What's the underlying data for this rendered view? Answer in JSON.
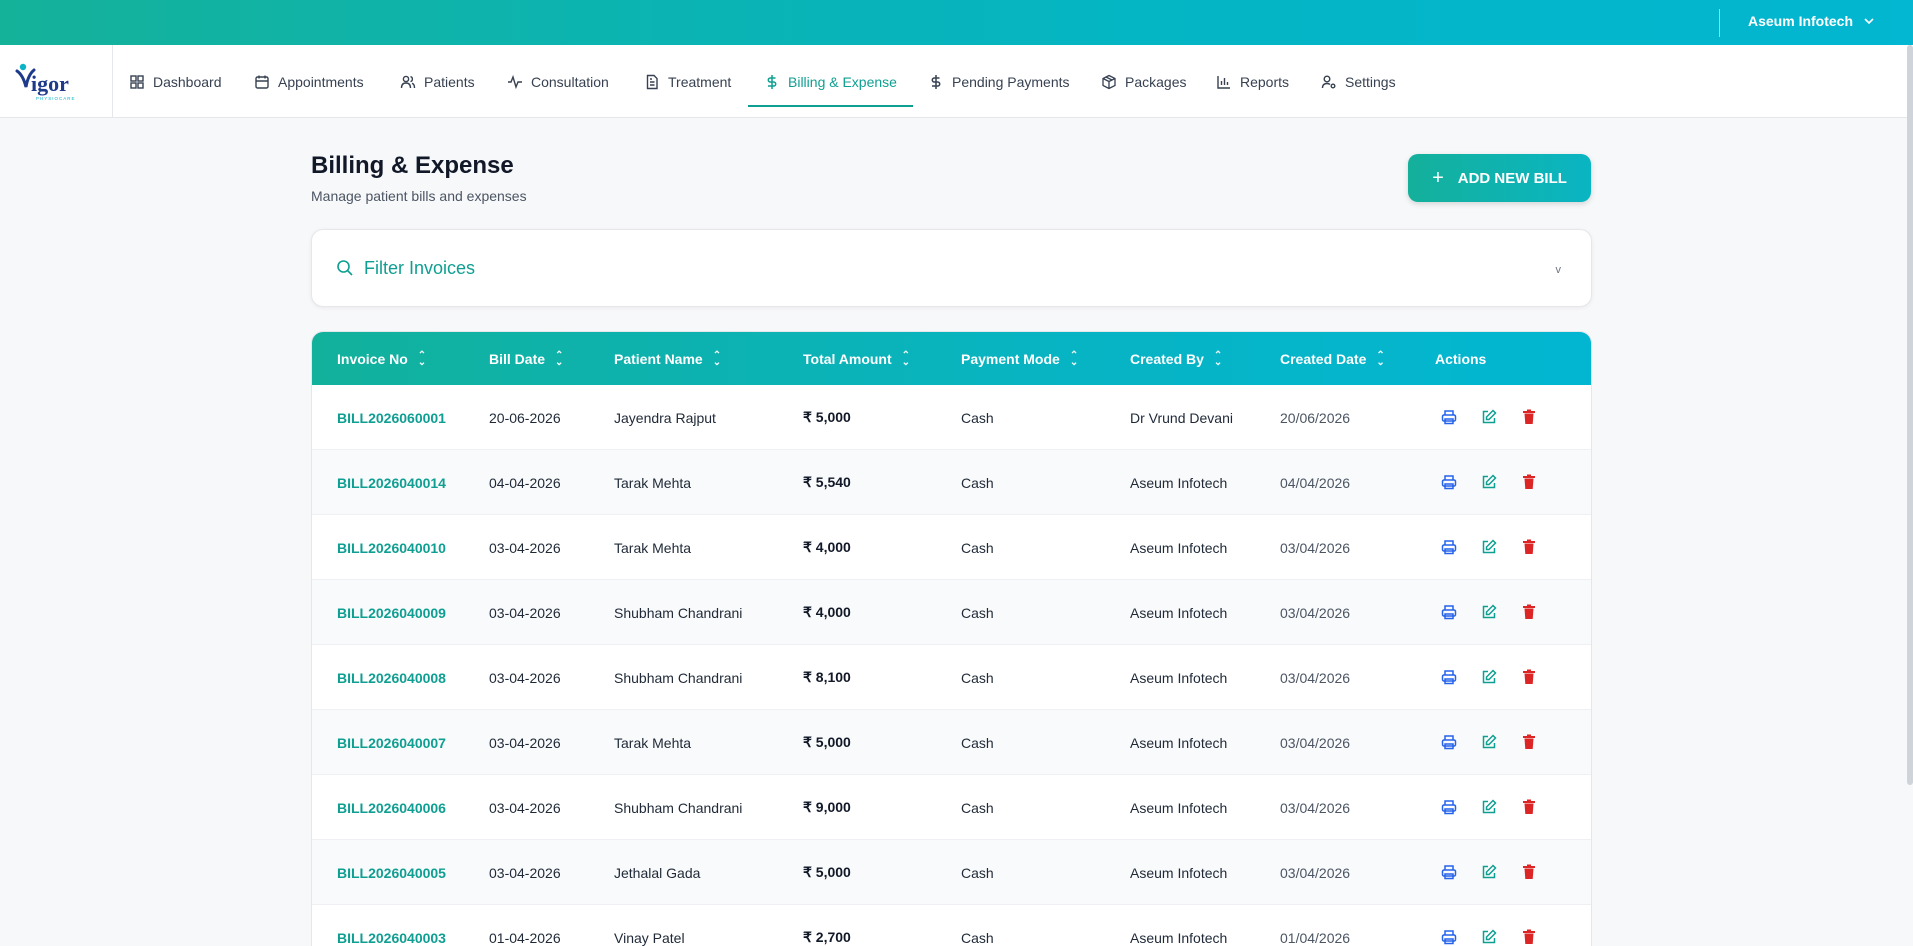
{
  "topbar": {
    "user_name": "Aseum Infotech"
  },
  "logo": {
    "text": "igor",
    "tagline": "PHYSIOCARE"
  },
  "nav": [
    {
      "label": "Dashboard",
      "icon": "grid-icon"
    },
    {
      "label": "Appointments",
      "icon": "calendar-icon"
    },
    {
      "label": "Patients",
      "icon": "users-icon"
    },
    {
      "label": "Consultation",
      "icon": "activity-icon"
    },
    {
      "label": "Treatment",
      "icon": "file-icon"
    },
    {
      "label": "Billing & Expense",
      "icon": "dollar-icon",
      "active": true
    },
    {
      "label": "Pending Payments",
      "icon": "dollar-icon"
    },
    {
      "label": "Packages",
      "icon": "package-icon"
    },
    {
      "label": "Reports",
      "icon": "bar-chart-icon"
    },
    {
      "label": "Settings",
      "icon": "user-cog-icon"
    }
  ],
  "page": {
    "title": "Billing & Expense",
    "subtitle": "Manage patient bills and expenses",
    "add_button": "ADD NEW BILL"
  },
  "filter": {
    "label": "Filter Invoices",
    "chevron": "v"
  },
  "table": {
    "headers": [
      "Invoice No",
      "Bill Date",
      "Patient Name",
      "Total Amount",
      "Payment Mode",
      "Created By",
      "Created Date",
      "Actions"
    ],
    "rows": [
      {
        "invoice": "BILL2026060001",
        "bill_date": "20-06-2026",
        "patient": "Jayendra Rajput",
        "amount": "₹ 5,000",
        "mode": "Cash",
        "created_by": "Dr Vrund Devani",
        "created_date": "20/06/2026"
      },
      {
        "invoice": "BILL2026040014",
        "bill_date": "04-04-2026",
        "patient": "Tarak Mehta",
        "amount": "₹ 5,540",
        "mode": "Cash",
        "created_by": "Aseum Infotech",
        "created_date": "04/04/2026"
      },
      {
        "invoice": "BILL2026040010",
        "bill_date": "03-04-2026",
        "patient": "Tarak Mehta",
        "amount": "₹ 4,000",
        "mode": "Cash",
        "created_by": "Aseum Infotech",
        "created_date": "03/04/2026"
      },
      {
        "invoice": "BILL2026040009",
        "bill_date": "03-04-2026",
        "patient": "Shubham Chandrani",
        "amount": "₹ 4,000",
        "mode": "Cash",
        "created_by": "Aseum Infotech",
        "created_date": "03/04/2026"
      },
      {
        "invoice": "BILL2026040008",
        "bill_date": "03-04-2026",
        "patient": "Shubham Chandrani",
        "amount": "₹ 8,100",
        "mode": "Cash",
        "created_by": "Aseum Infotech",
        "created_date": "03/04/2026"
      },
      {
        "invoice": "BILL2026040007",
        "bill_date": "03-04-2026",
        "patient": "Tarak Mehta",
        "amount": "₹ 5,000",
        "mode": "Cash",
        "created_by": "Aseum Infotech",
        "created_date": "03/04/2026"
      },
      {
        "invoice": "BILL2026040006",
        "bill_date": "03-04-2026",
        "patient": "Shubham Chandrani",
        "amount": "₹ 9,000",
        "mode": "Cash",
        "created_by": "Aseum Infotech",
        "created_date": "03/04/2026"
      },
      {
        "invoice": "BILL2026040005",
        "bill_date": "03-04-2026",
        "patient": "Jethalal Gada",
        "amount": "₹ 5,000",
        "mode": "Cash",
        "created_by": "Aseum Infotech",
        "created_date": "03/04/2026"
      },
      {
        "invoice": "BILL2026040003",
        "bill_date": "01-04-2026",
        "patient": "Vinay Patel",
        "amount": "₹ 2,700",
        "mode": "Cash",
        "created_by": "Aseum Infotech",
        "created_date": "01/04/2026"
      }
    ]
  },
  "colors": {
    "accent": "#0f9f92",
    "header_gradient_start": "#12b19c",
    "header_gradient_end": "#02b6d2",
    "print": "#2563eb",
    "edit": "#0f9f92",
    "delete": "#dc2626"
  }
}
